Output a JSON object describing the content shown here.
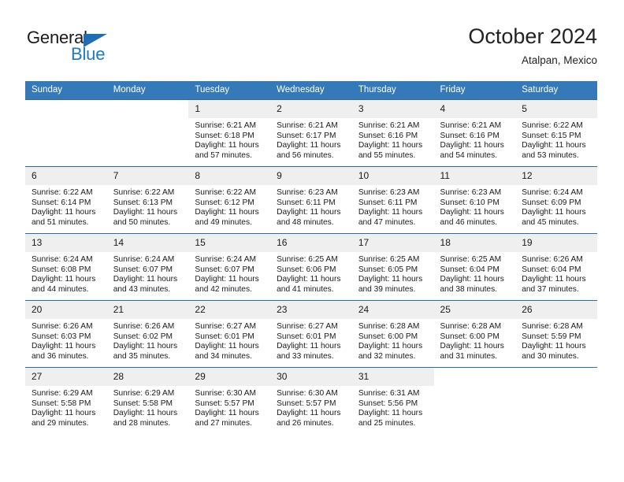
{
  "logo": {
    "word_one": "General",
    "word_two": "Blue",
    "triangle_color": "#1f6eb5",
    "blue_color": "#1f7ac4"
  },
  "header": {
    "month_title": "October 2024",
    "location": "Atalpan, Mexico"
  },
  "theme": {
    "header_bg": "#3579b8",
    "row_border": "#2e6da4",
    "daynum_bg": "#efefef",
    "text": "#1a1a1a"
  },
  "calendar": {
    "weekday_headers": [
      "Sunday",
      "Monday",
      "Tuesday",
      "Wednesday",
      "Thursday",
      "Friday",
      "Saturday"
    ],
    "weeks": [
      [
        {
          "day": "",
          "sunrise": "",
          "sunset": "",
          "daylight_line1": "",
          "daylight_line2": "",
          "blank": true
        },
        {
          "day": "",
          "sunrise": "",
          "sunset": "",
          "daylight_line1": "",
          "daylight_line2": "",
          "blank": true
        },
        {
          "day": "1",
          "sunrise": "Sunrise: 6:21 AM",
          "sunset": "Sunset: 6:18 PM",
          "daylight_line1": "Daylight: 11 hours",
          "daylight_line2": "and 57 minutes."
        },
        {
          "day": "2",
          "sunrise": "Sunrise: 6:21 AM",
          "sunset": "Sunset: 6:17 PM",
          "daylight_line1": "Daylight: 11 hours",
          "daylight_line2": "and 56 minutes."
        },
        {
          "day": "3",
          "sunrise": "Sunrise: 6:21 AM",
          "sunset": "Sunset: 6:16 PM",
          "daylight_line1": "Daylight: 11 hours",
          "daylight_line2": "and 55 minutes."
        },
        {
          "day": "4",
          "sunrise": "Sunrise: 6:21 AM",
          "sunset": "Sunset: 6:16 PM",
          "daylight_line1": "Daylight: 11 hours",
          "daylight_line2": "and 54 minutes."
        },
        {
          "day": "5",
          "sunrise": "Sunrise: 6:22 AM",
          "sunset": "Sunset: 6:15 PM",
          "daylight_line1": "Daylight: 11 hours",
          "daylight_line2": "and 53 minutes."
        }
      ],
      [
        {
          "day": "6",
          "sunrise": "Sunrise: 6:22 AM",
          "sunset": "Sunset: 6:14 PM",
          "daylight_line1": "Daylight: 11 hours",
          "daylight_line2": "and 51 minutes."
        },
        {
          "day": "7",
          "sunrise": "Sunrise: 6:22 AM",
          "sunset": "Sunset: 6:13 PM",
          "daylight_line1": "Daylight: 11 hours",
          "daylight_line2": "and 50 minutes."
        },
        {
          "day": "8",
          "sunrise": "Sunrise: 6:22 AM",
          "sunset": "Sunset: 6:12 PM",
          "daylight_line1": "Daylight: 11 hours",
          "daylight_line2": "and 49 minutes."
        },
        {
          "day": "9",
          "sunrise": "Sunrise: 6:23 AM",
          "sunset": "Sunset: 6:11 PM",
          "daylight_line1": "Daylight: 11 hours",
          "daylight_line2": "and 48 minutes."
        },
        {
          "day": "10",
          "sunrise": "Sunrise: 6:23 AM",
          "sunset": "Sunset: 6:11 PM",
          "daylight_line1": "Daylight: 11 hours",
          "daylight_line2": "and 47 minutes."
        },
        {
          "day": "11",
          "sunrise": "Sunrise: 6:23 AM",
          "sunset": "Sunset: 6:10 PM",
          "daylight_line1": "Daylight: 11 hours",
          "daylight_line2": "and 46 minutes."
        },
        {
          "day": "12",
          "sunrise": "Sunrise: 6:24 AM",
          "sunset": "Sunset: 6:09 PM",
          "daylight_line1": "Daylight: 11 hours",
          "daylight_line2": "and 45 minutes."
        }
      ],
      [
        {
          "day": "13",
          "sunrise": "Sunrise: 6:24 AM",
          "sunset": "Sunset: 6:08 PM",
          "daylight_line1": "Daylight: 11 hours",
          "daylight_line2": "and 44 minutes."
        },
        {
          "day": "14",
          "sunrise": "Sunrise: 6:24 AM",
          "sunset": "Sunset: 6:07 PM",
          "daylight_line1": "Daylight: 11 hours",
          "daylight_line2": "and 43 minutes."
        },
        {
          "day": "15",
          "sunrise": "Sunrise: 6:24 AM",
          "sunset": "Sunset: 6:07 PM",
          "daylight_line1": "Daylight: 11 hours",
          "daylight_line2": "and 42 minutes."
        },
        {
          "day": "16",
          "sunrise": "Sunrise: 6:25 AM",
          "sunset": "Sunset: 6:06 PM",
          "daylight_line1": "Daylight: 11 hours",
          "daylight_line2": "and 41 minutes."
        },
        {
          "day": "17",
          "sunrise": "Sunrise: 6:25 AM",
          "sunset": "Sunset: 6:05 PM",
          "daylight_line1": "Daylight: 11 hours",
          "daylight_line2": "and 39 minutes."
        },
        {
          "day": "18",
          "sunrise": "Sunrise: 6:25 AM",
          "sunset": "Sunset: 6:04 PM",
          "daylight_line1": "Daylight: 11 hours",
          "daylight_line2": "and 38 minutes."
        },
        {
          "day": "19",
          "sunrise": "Sunrise: 6:26 AM",
          "sunset": "Sunset: 6:04 PM",
          "daylight_line1": "Daylight: 11 hours",
          "daylight_line2": "and 37 minutes."
        }
      ],
      [
        {
          "day": "20",
          "sunrise": "Sunrise: 6:26 AM",
          "sunset": "Sunset: 6:03 PM",
          "daylight_line1": "Daylight: 11 hours",
          "daylight_line2": "and 36 minutes."
        },
        {
          "day": "21",
          "sunrise": "Sunrise: 6:26 AM",
          "sunset": "Sunset: 6:02 PM",
          "daylight_line1": "Daylight: 11 hours",
          "daylight_line2": "and 35 minutes."
        },
        {
          "day": "22",
          "sunrise": "Sunrise: 6:27 AM",
          "sunset": "Sunset: 6:01 PM",
          "daylight_line1": "Daylight: 11 hours",
          "daylight_line2": "and 34 minutes."
        },
        {
          "day": "23",
          "sunrise": "Sunrise: 6:27 AM",
          "sunset": "Sunset: 6:01 PM",
          "daylight_line1": "Daylight: 11 hours",
          "daylight_line2": "and 33 minutes."
        },
        {
          "day": "24",
          "sunrise": "Sunrise: 6:28 AM",
          "sunset": "Sunset: 6:00 PM",
          "daylight_line1": "Daylight: 11 hours",
          "daylight_line2": "and 32 minutes."
        },
        {
          "day": "25",
          "sunrise": "Sunrise: 6:28 AM",
          "sunset": "Sunset: 6:00 PM",
          "daylight_line1": "Daylight: 11 hours",
          "daylight_line2": "and 31 minutes."
        },
        {
          "day": "26",
          "sunrise": "Sunrise: 6:28 AM",
          "sunset": "Sunset: 5:59 PM",
          "daylight_line1": "Daylight: 11 hours",
          "daylight_line2": "and 30 minutes."
        }
      ],
      [
        {
          "day": "27",
          "sunrise": "Sunrise: 6:29 AM",
          "sunset": "Sunset: 5:58 PM",
          "daylight_line1": "Daylight: 11 hours",
          "daylight_line2": "and 29 minutes."
        },
        {
          "day": "28",
          "sunrise": "Sunrise: 6:29 AM",
          "sunset": "Sunset: 5:58 PM",
          "daylight_line1": "Daylight: 11 hours",
          "daylight_line2": "and 28 minutes."
        },
        {
          "day": "29",
          "sunrise": "Sunrise: 6:30 AM",
          "sunset": "Sunset: 5:57 PM",
          "daylight_line1": "Daylight: 11 hours",
          "daylight_line2": "and 27 minutes."
        },
        {
          "day": "30",
          "sunrise": "Sunrise: 6:30 AM",
          "sunset": "Sunset: 5:57 PM",
          "daylight_line1": "Daylight: 11 hours",
          "daylight_line2": "and 26 minutes."
        },
        {
          "day": "31",
          "sunrise": "Sunrise: 6:31 AM",
          "sunset": "Sunset: 5:56 PM",
          "daylight_line1": "Daylight: 11 hours",
          "daylight_line2": "and 25 minutes."
        },
        {
          "day": "",
          "sunrise": "",
          "sunset": "",
          "daylight_line1": "",
          "daylight_line2": "",
          "blank": true
        },
        {
          "day": "",
          "sunrise": "",
          "sunset": "",
          "daylight_line1": "",
          "daylight_line2": "",
          "blank": true
        }
      ]
    ]
  }
}
